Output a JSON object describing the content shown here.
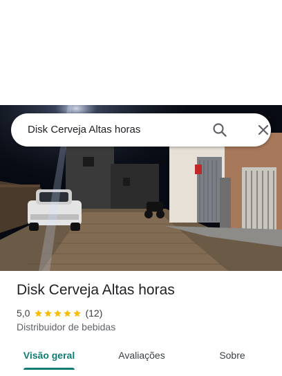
{
  "search": {
    "query": "Disk Cerveja Altas horas"
  },
  "place": {
    "name": "Disk Cerveja Altas horas",
    "rating": "5,0",
    "stars": 5,
    "review_count": "(12)",
    "category": "Distribuidor de bebidas"
  },
  "tabs": [
    {
      "label": "Visão geral",
      "active": true
    },
    {
      "label": "Avaliações",
      "active": false
    },
    {
      "label": "Sobre",
      "active": false
    }
  ],
  "colors": {
    "accent": "#0e7c74",
    "star": "#fbbc04",
    "text": "#202124",
    "secondary_text": "#5f6368"
  },
  "icons": [
    "search-icon",
    "close-icon",
    "star-icon"
  ]
}
